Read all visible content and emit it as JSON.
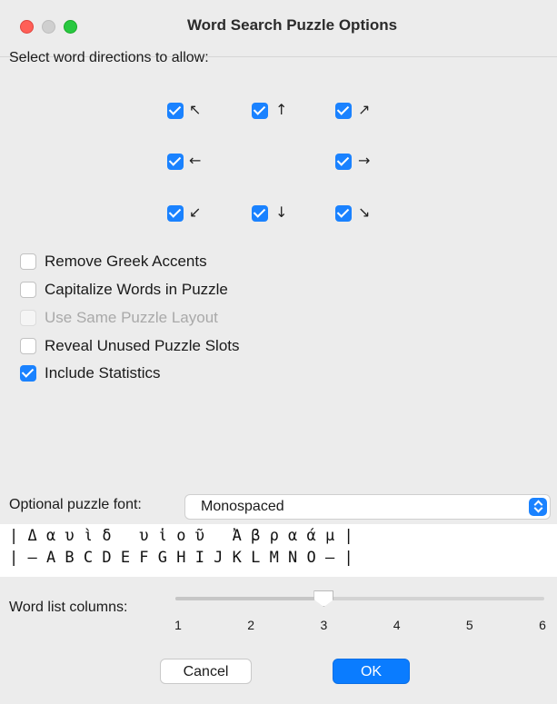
{
  "window": {
    "title": "Word Search Puzzle Options"
  },
  "directions": {
    "prompt": "Select word directions to allow:",
    "items": [
      {
        "arrow": "↖",
        "checked": true,
        "icon": "arrow-up-left-icon"
      },
      {
        "arrow": "↑",
        "checked": true,
        "icon": "arrow-up-icon"
      },
      {
        "arrow": "↗",
        "checked": true,
        "icon": "arrow-up-right-icon"
      },
      {
        "arrow": "←",
        "checked": true,
        "icon": "arrow-left-icon"
      },
      {
        "arrow": "→",
        "checked": true,
        "icon": "arrow-right-icon"
      },
      {
        "arrow": "↙",
        "checked": true,
        "icon": "arrow-down-left-icon"
      },
      {
        "arrow": "↓",
        "checked": true,
        "icon": "arrow-down-icon"
      },
      {
        "arrow": "↘",
        "checked": true,
        "icon": "arrow-down-right-icon"
      }
    ]
  },
  "options": [
    {
      "label": "Remove Greek Accents",
      "checked": false,
      "enabled": true
    },
    {
      "label": "Capitalize Words in Puzzle",
      "checked": false,
      "enabled": true
    },
    {
      "label": "Use Same Puzzle Layout",
      "checked": false,
      "enabled": false
    },
    {
      "label": "Reveal Unused Puzzle Slots",
      "checked": false,
      "enabled": true
    },
    {
      "label": "Include Statistics",
      "checked": true,
      "enabled": true
    }
  ],
  "font": {
    "label": "Optional puzzle font:",
    "selected": "Monospaced",
    "preview_line1": "| Δ α υ ὶ δ   υ ἱ ο ῦ   Ἀ β ρ α ά μ |",
    "preview_line2": "| – A B C D E F G H I J K L M N O – |"
  },
  "columns": {
    "label": "Word list columns:",
    "ticks": [
      "1",
      "2",
      "3",
      "4",
      "5",
      "6"
    ],
    "value": 3,
    "min": 1,
    "max": 6
  },
  "buttons": {
    "cancel": "Cancel",
    "ok": "OK"
  },
  "colors": {
    "accent": "#1a82ff",
    "close": "#ff5f57",
    "maximize": "#28c840",
    "background": "#ececec"
  }
}
